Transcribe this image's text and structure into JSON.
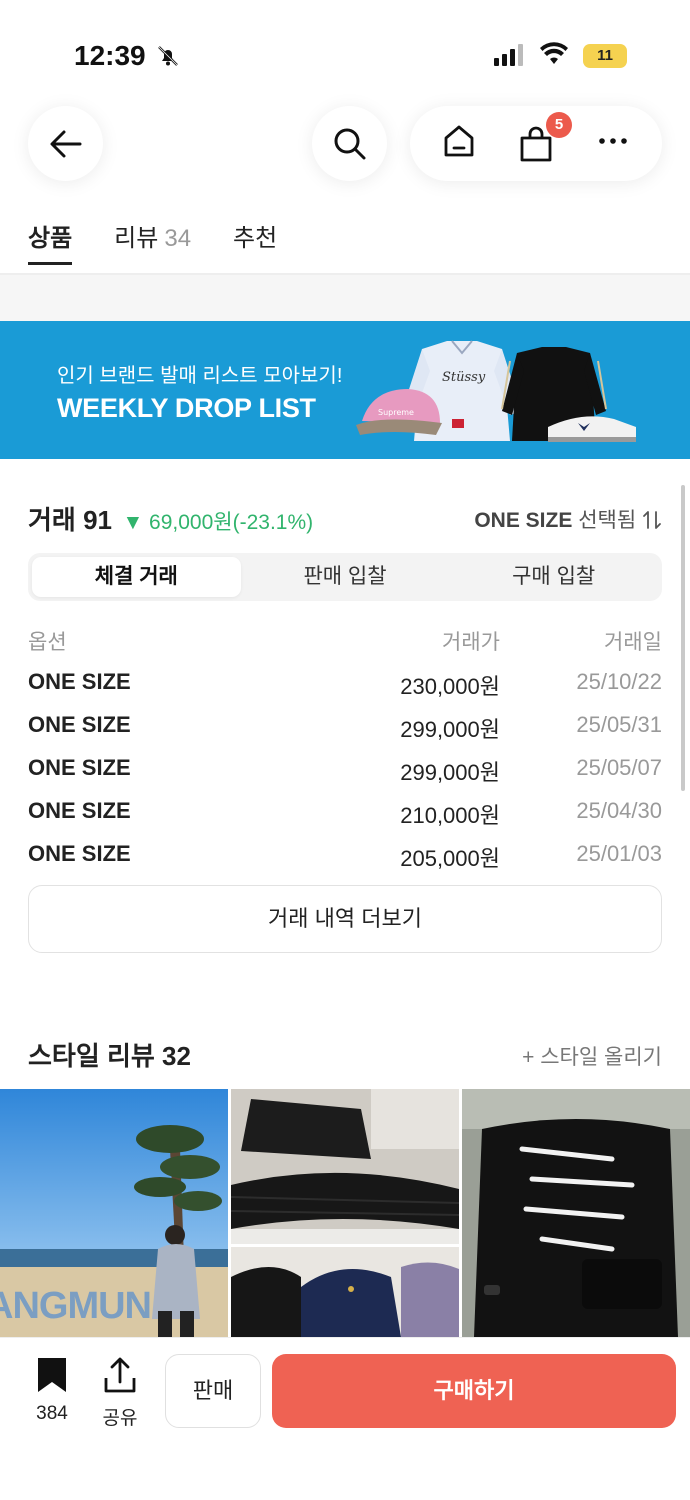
{
  "status": {
    "time": "12:39",
    "battery": "11"
  },
  "nav": {
    "cart_count": "5"
  },
  "tabs": [
    {
      "label": "상품"
    },
    {
      "label": "리뷰",
      "count": "34"
    },
    {
      "label": "추천"
    }
  ],
  "banner": {
    "subtitle": "인기 브랜드 발매 리스트 모아보기!",
    "title": "WEEKLY DROP LIST"
  },
  "trade": {
    "title": "거래 91",
    "change": "▼ 69,000원(-23.1%)",
    "size_value": "ONE SIZE",
    "size_suffix": "선택됨",
    "segments": [
      "체결 거래",
      "판매 입찰",
      "구매 입찰"
    ],
    "headers": [
      "옵션",
      "거래가",
      "거래일"
    ],
    "rows": [
      {
        "option": "ONE SIZE",
        "price": "230,000원",
        "date": "25/10/22"
      },
      {
        "option": "ONE SIZE",
        "price": "299,000원",
        "date": "25/05/31"
      },
      {
        "option": "ONE SIZE",
        "price": "299,000원",
        "date": "25/05/07"
      },
      {
        "option": "ONE SIZE",
        "price": "210,000원",
        "date": "25/04/30"
      },
      {
        "option": "ONE SIZE",
        "price": "205,000원",
        "date": "25/01/03"
      }
    ],
    "more_label": "거래 내역 더보기"
  },
  "style": {
    "title": "스타일 리뷰 32",
    "upload_label": "+ 스타일 올리기",
    "photo1_text": "ANGMUN"
  },
  "bottom": {
    "bookmark_count": "384",
    "share_label": "공유",
    "sell_label": "판매",
    "buy_label": "구매하기"
  },
  "colors": {
    "accent": "#ef6253",
    "banner": "#1a9bd6",
    "price_down": "#31b46d"
  }
}
